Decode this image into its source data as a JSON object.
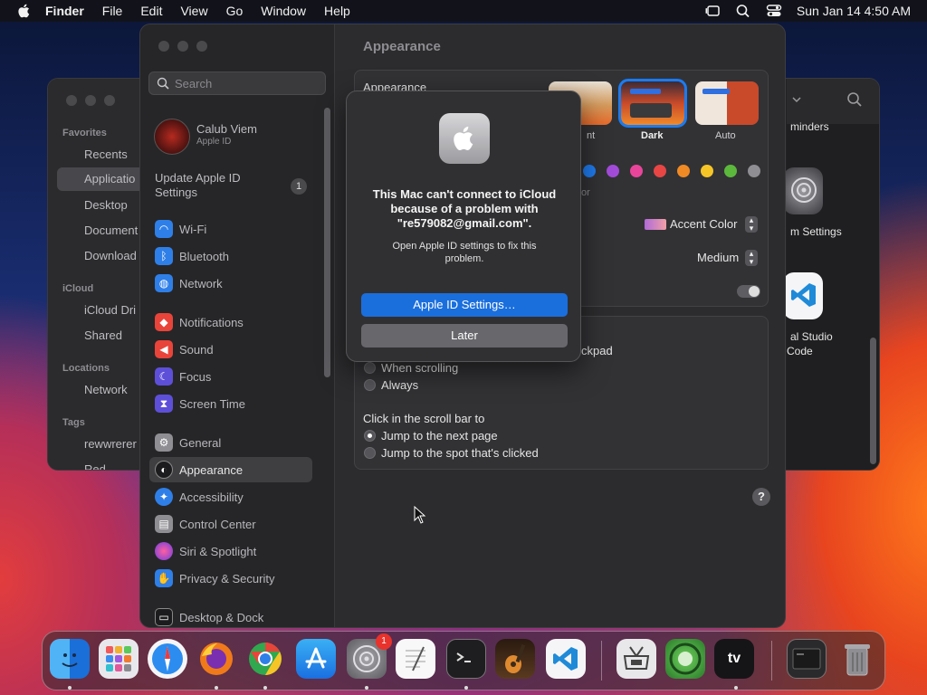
{
  "menubar": {
    "app": "Finder",
    "items": [
      "File",
      "Edit",
      "View",
      "Go",
      "Window",
      "Help"
    ],
    "clock": "Sun Jan 14  4:50 AM"
  },
  "finder": {
    "favorites_header": "Favorites",
    "favorites": [
      "Recents",
      "Applicatio",
      "Desktop",
      "Document",
      "Download"
    ],
    "icloud_header": "iCloud",
    "icloud": [
      "iCloud Dri",
      "Shared"
    ],
    "locations_header": "Locations",
    "locations": [
      "Network"
    ],
    "tags_header": "Tags",
    "tags": [
      "rewwrerer",
      "Red"
    ],
    "apps": [
      "minders",
      "m Settings",
      "al Studio",
      "Code"
    ]
  },
  "settings": {
    "search_placeholder": "Search",
    "user_name": "Calub Viem",
    "user_sub": "Apple ID",
    "update_label": "Update Apple ID Settings",
    "update_count": "1",
    "nav": [
      {
        "label": "Wi-Fi",
        "icon": "wifi-icon",
        "color": "#2f7fe8"
      },
      {
        "label": "Bluetooth",
        "icon": "bluetooth-icon",
        "color": "#2f7fe8"
      },
      {
        "label": "Network",
        "icon": "globe-icon",
        "color": "#2f7fe8"
      },
      {
        "label": "Notifications",
        "icon": "bell-icon",
        "color": "#e8443a"
      },
      {
        "label": "Sound",
        "icon": "speaker-icon",
        "color": "#e8443a"
      },
      {
        "label": "Focus",
        "icon": "moon-icon",
        "color": "#5e4fd8"
      },
      {
        "label": "Screen Time",
        "icon": "hourglass-icon",
        "color": "#5e4fd8"
      },
      {
        "label": "General",
        "icon": "gear-icon",
        "color": "#8e8e93"
      },
      {
        "label": "Appearance",
        "icon": "appearance-icon",
        "color": "#2c2c2e"
      },
      {
        "label": "Accessibility",
        "icon": "accessibility-icon",
        "color": "#2f7fe8"
      },
      {
        "label": "Control Center",
        "icon": "control-center-icon",
        "color": "#8e8e93"
      },
      {
        "label": "Siri & Spotlight",
        "icon": "siri-icon",
        "color": "#c43ad0"
      },
      {
        "label": "Privacy & Security",
        "icon": "hand-icon",
        "color": "#2f7fe8"
      },
      {
        "label": "Desktop & Dock",
        "icon": "dock-icon",
        "color": "#2c2c2e"
      }
    ],
    "page_title": "Appearance",
    "appearance_row": "Appearance",
    "modes": [
      "Light",
      "Dark",
      "Auto"
    ],
    "mode_fragment": "nt",
    "highlight_fragment": "or",
    "highlight_value": "Accent Color",
    "sidebar_size_value": "Medium",
    "scroll_fragment": "ckpad",
    "show_scroll_options": [
      "When scrolling",
      "Always"
    ],
    "click_scroll_title": "Click in the scroll bar to",
    "click_scroll_options": [
      "Jump to the next page",
      "Jump to the spot that's clicked"
    ],
    "help": "?"
  },
  "dialog": {
    "title": "This Mac can't connect to iCloud because of a problem with \"re579082@gmail.com\".",
    "message": "Open Apple ID settings to fix this problem.",
    "primary_button": "Apple ID Settings…",
    "secondary_button": "Later"
  },
  "dock": {
    "apps": [
      "finder-icon",
      "launchpad-icon",
      "safari-icon",
      "firefox-icon",
      "chrome-icon",
      "app-store-icon",
      "system-settings-icon",
      "textedit-icon",
      "terminal-icon",
      "garageband-icon",
      "vscode-icon",
      "utility-icon",
      "hdr-app-icon",
      "apple-tv-icon",
      "console-icon",
      "trash-icon"
    ],
    "settings_badge": "1",
    "tv_label": "tv"
  },
  "colors": {
    "accent": "#1a6fdd",
    "swatches": [
      "#1f7cf0",
      "#a24bd8",
      "#e8459a",
      "#e84545",
      "#f08a24",
      "#f5c527",
      "#5cb83c",
      "#8e8e93"
    ]
  }
}
